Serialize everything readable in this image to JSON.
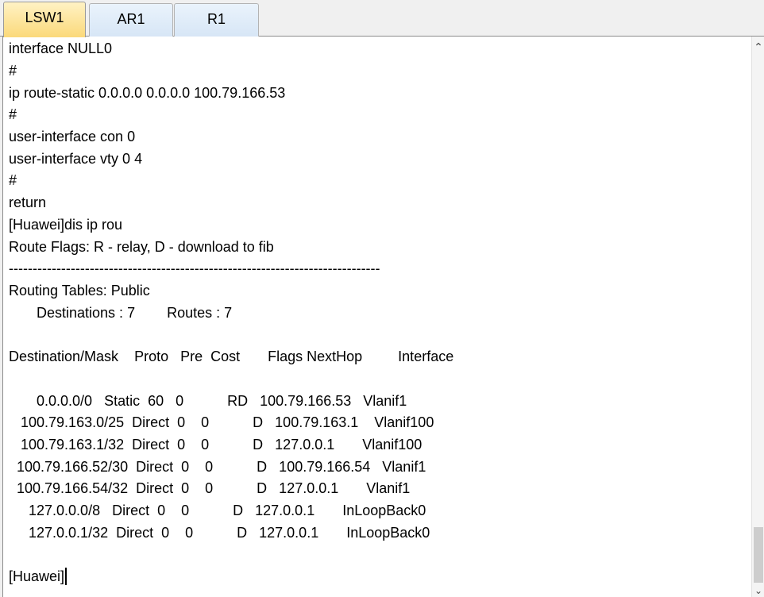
{
  "tabs": [
    {
      "label": "LSW1",
      "active": true
    },
    {
      "label": "AR1",
      "active": false
    },
    {
      "label": "R1",
      "active": false
    }
  ],
  "terminal": {
    "lines": [
      "interface NULL0",
      "#",
      "ip route-static 0.0.0.0 0.0.0.0 100.79.166.53",
      "#",
      "user-interface con 0",
      "user-interface vty 0 4",
      "#",
      "return",
      "[Huawei]dis ip rou",
      "Route Flags: R - relay, D - download to fib",
      "------------------------------------------------------------------------------",
      "Routing Tables: Public",
      "       Destinations : 7        Routes : 7",
      "",
      "Destination/Mask    Proto   Pre  Cost       Flags NextHop         Interface",
      "",
      "       0.0.0.0/0   Static  60   0           RD   100.79.166.53   Vlanif1",
      "   100.79.163.0/25  Direct  0    0           D   100.79.163.1    Vlanif100",
      "   100.79.163.1/32  Direct  0    0           D   127.0.0.1       Vlanif100",
      "  100.79.166.52/30  Direct  0    0           D   100.79.166.54   Vlanif1",
      "  100.79.166.54/32  Direct  0    0           D   127.0.0.1       Vlanif1",
      "     127.0.0.0/8   Direct  0    0           D   127.0.0.1       InLoopBack0",
      "     127.0.0.1/32  Direct  0    0           D   127.0.0.1       InLoopBack0",
      "",
      "[Huawei]"
    ]
  },
  "scrollbar": {
    "up_icon": "chevron-up-icon",
    "down_icon": "chevron-down-icon",
    "position": 0.96
  }
}
